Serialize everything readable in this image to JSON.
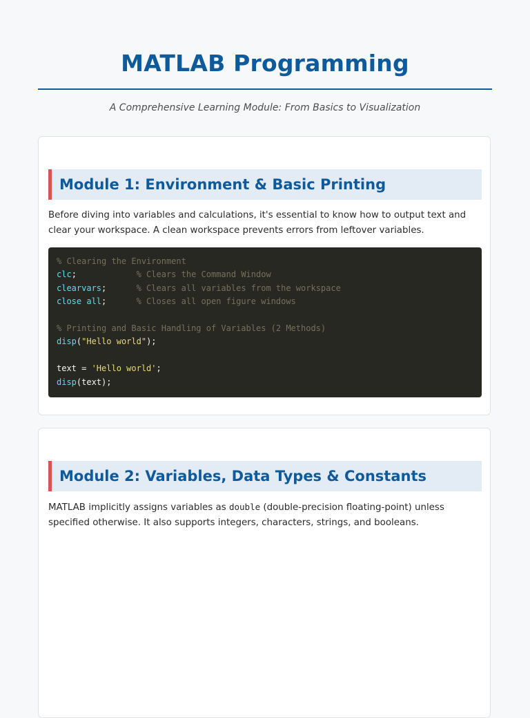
{
  "header": {
    "title": "MATLAB Programming",
    "subtitle": "A Comprehensive Learning Module: From Basics to Visualization"
  },
  "modules": [
    {
      "heading": "Module 1: Environment & Basic Printing",
      "paragraph": "Before diving into variables and calculations, it's essential to know how to output text and clear your workspace. A clean workspace prevents errors from leftover variables.",
      "code_lines": [
        [
          {
            "t": "comment",
            "v": "% Clearing the Environment"
          }
        ],
        [
          {
            "t": "fn",
            "v": "clc"
          },
          {
            "t": "plain",
            "v": ";            "
          },
          {
            "t": "comment",
            "v": "% Clears the Command Window"
          }
        ],
        [
          {
            "t": "fn",
            "v": "clearvars"
          },
          {
            "t": "plain",
            "v": ";      "
          },
          {
            "t": "comment",
            "v": "% Clears all variables from the workspace"
          }
        ],
        [
          {
            "t": "fn",
            "v": "close all"
          },
          {
            "t": "plain",
            "v": ";      "
          },
          {
            "t": "comment",
            "v": "% Closes all open figure windows"
          }
        ],
        [],
        [
          {
            "t": "comment",
            "v": "% Printing and Basic Handling of Variables (2 Methods)"
          }
        ],
        [
          {
            "t": "fn",
            "v": "disp"
          },
          {
            "t": "plain",
            "v": "("
          },
          {
            "t": "str",
            "v": "\"Hello world\""
          },
          {
            "t": "plain",
            "v": ");"
          }
        ],
        [],
        [
          {
            "t": "plain",
            "v": "text = "
          },
          {
            "t": "str",
            "v": "'Hello world'"
          },
          {
            "t": "plain",
            "v": ";"
          }
        ],
        [
          {
            "t": "fn",
            "v": "disp"
          },
          {
            "t": "plain",
            "v": "(text);"
          }
        ]
      ]
    },
    {
      "heading": "Module 2: Variables, Data Types & Constants",
      "paragraph_before": "MATLAB implicitly assigns variables as ",
      "paragraph_code": "double",
      "paragraph_after": " (double-precision floating-point) unless specified otherwise. It also supports integers, characters, strings, and booleans."
    }
  ],
  "colors": {
    "accent": "#0f5a9b",
    "heading_bar": "#d9534f",
    "heading_bg": "#e3ebf5",
    "code_bg": "#272822",
    "code_comment": "#75715e",
    "code_function": "#66d9ef",
    "code_string": "#e6db74"
  }
}
